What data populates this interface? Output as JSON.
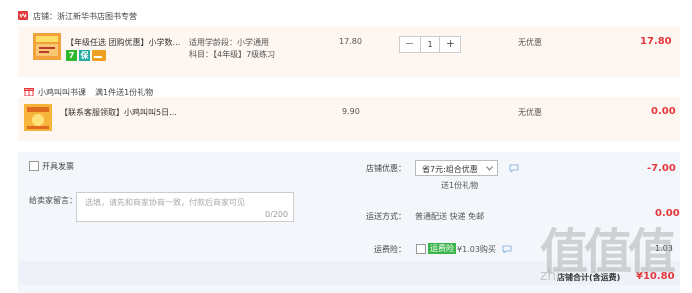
{
  "store": {
    "label": "店铺：",
    "name": "浙江新华书店图书专营"
  },
  "items": [
    {
      "title": "【年级任选 团购优惠】小学数...",
      "grade_label": "适用学龄段：小学通用",
      "subject_label": "科目：【4年级】7级练习",
      "unit_price": "17.80",
      "quantity": "1",
      "discount": "无优惠",
      "subtotal": "17.80",
      "badge_7": "7",
      "badge_green": "保"
    },
    {
      "title": "【联系客服领取】小鸡叫叫5日...",
      "unit_price": "9.90",
      "discount": "无优惠",
      "subtotal": "0.00"
    }
  ],
  "gift": {
    "name": "小鸡叫叫书课",
    "promo": "满1件送1份礼物"
  },
  "invoice": {
    "label": "开具发票"
  },
  "message": {
    "label": "给卖家留言：",
    "placeholder": "选填，请先和商家协商一致，付款后商家可见",
    "counter": "0/200"
  },
  "shop_discount": {
    "label": "店铺优惠：",
    "select_value": "省7元:组合优惠",
    "gift_note": "送1份礼物",
    "amount": "-7.00"
  },
  "shipping": {
    "label": "运送方式：",
    "method": "普通配送 快递 免邮",
    "amount": "0.00"
  },
  "insurance": {
    "label": "运费险：",
    "tag": "运费险",
    "text": "¥1.03购买",
    "amount": "1.03"
  },
  "total": {
    "label": "店铺合计(含运费)",
    "amount": "¥10.80"
  },
  "watermark": {
    "text": "值值值",
    "sub": "zhi"
  },
  "colors": {
    "accent_red": "#e4393c",
    "store_icon": "#e4393c",
    "badge_green": "#2eb82e",
    "badge_teal": "#23a8a0",
    "insurance_green": "#3bb54a"
  }
}
